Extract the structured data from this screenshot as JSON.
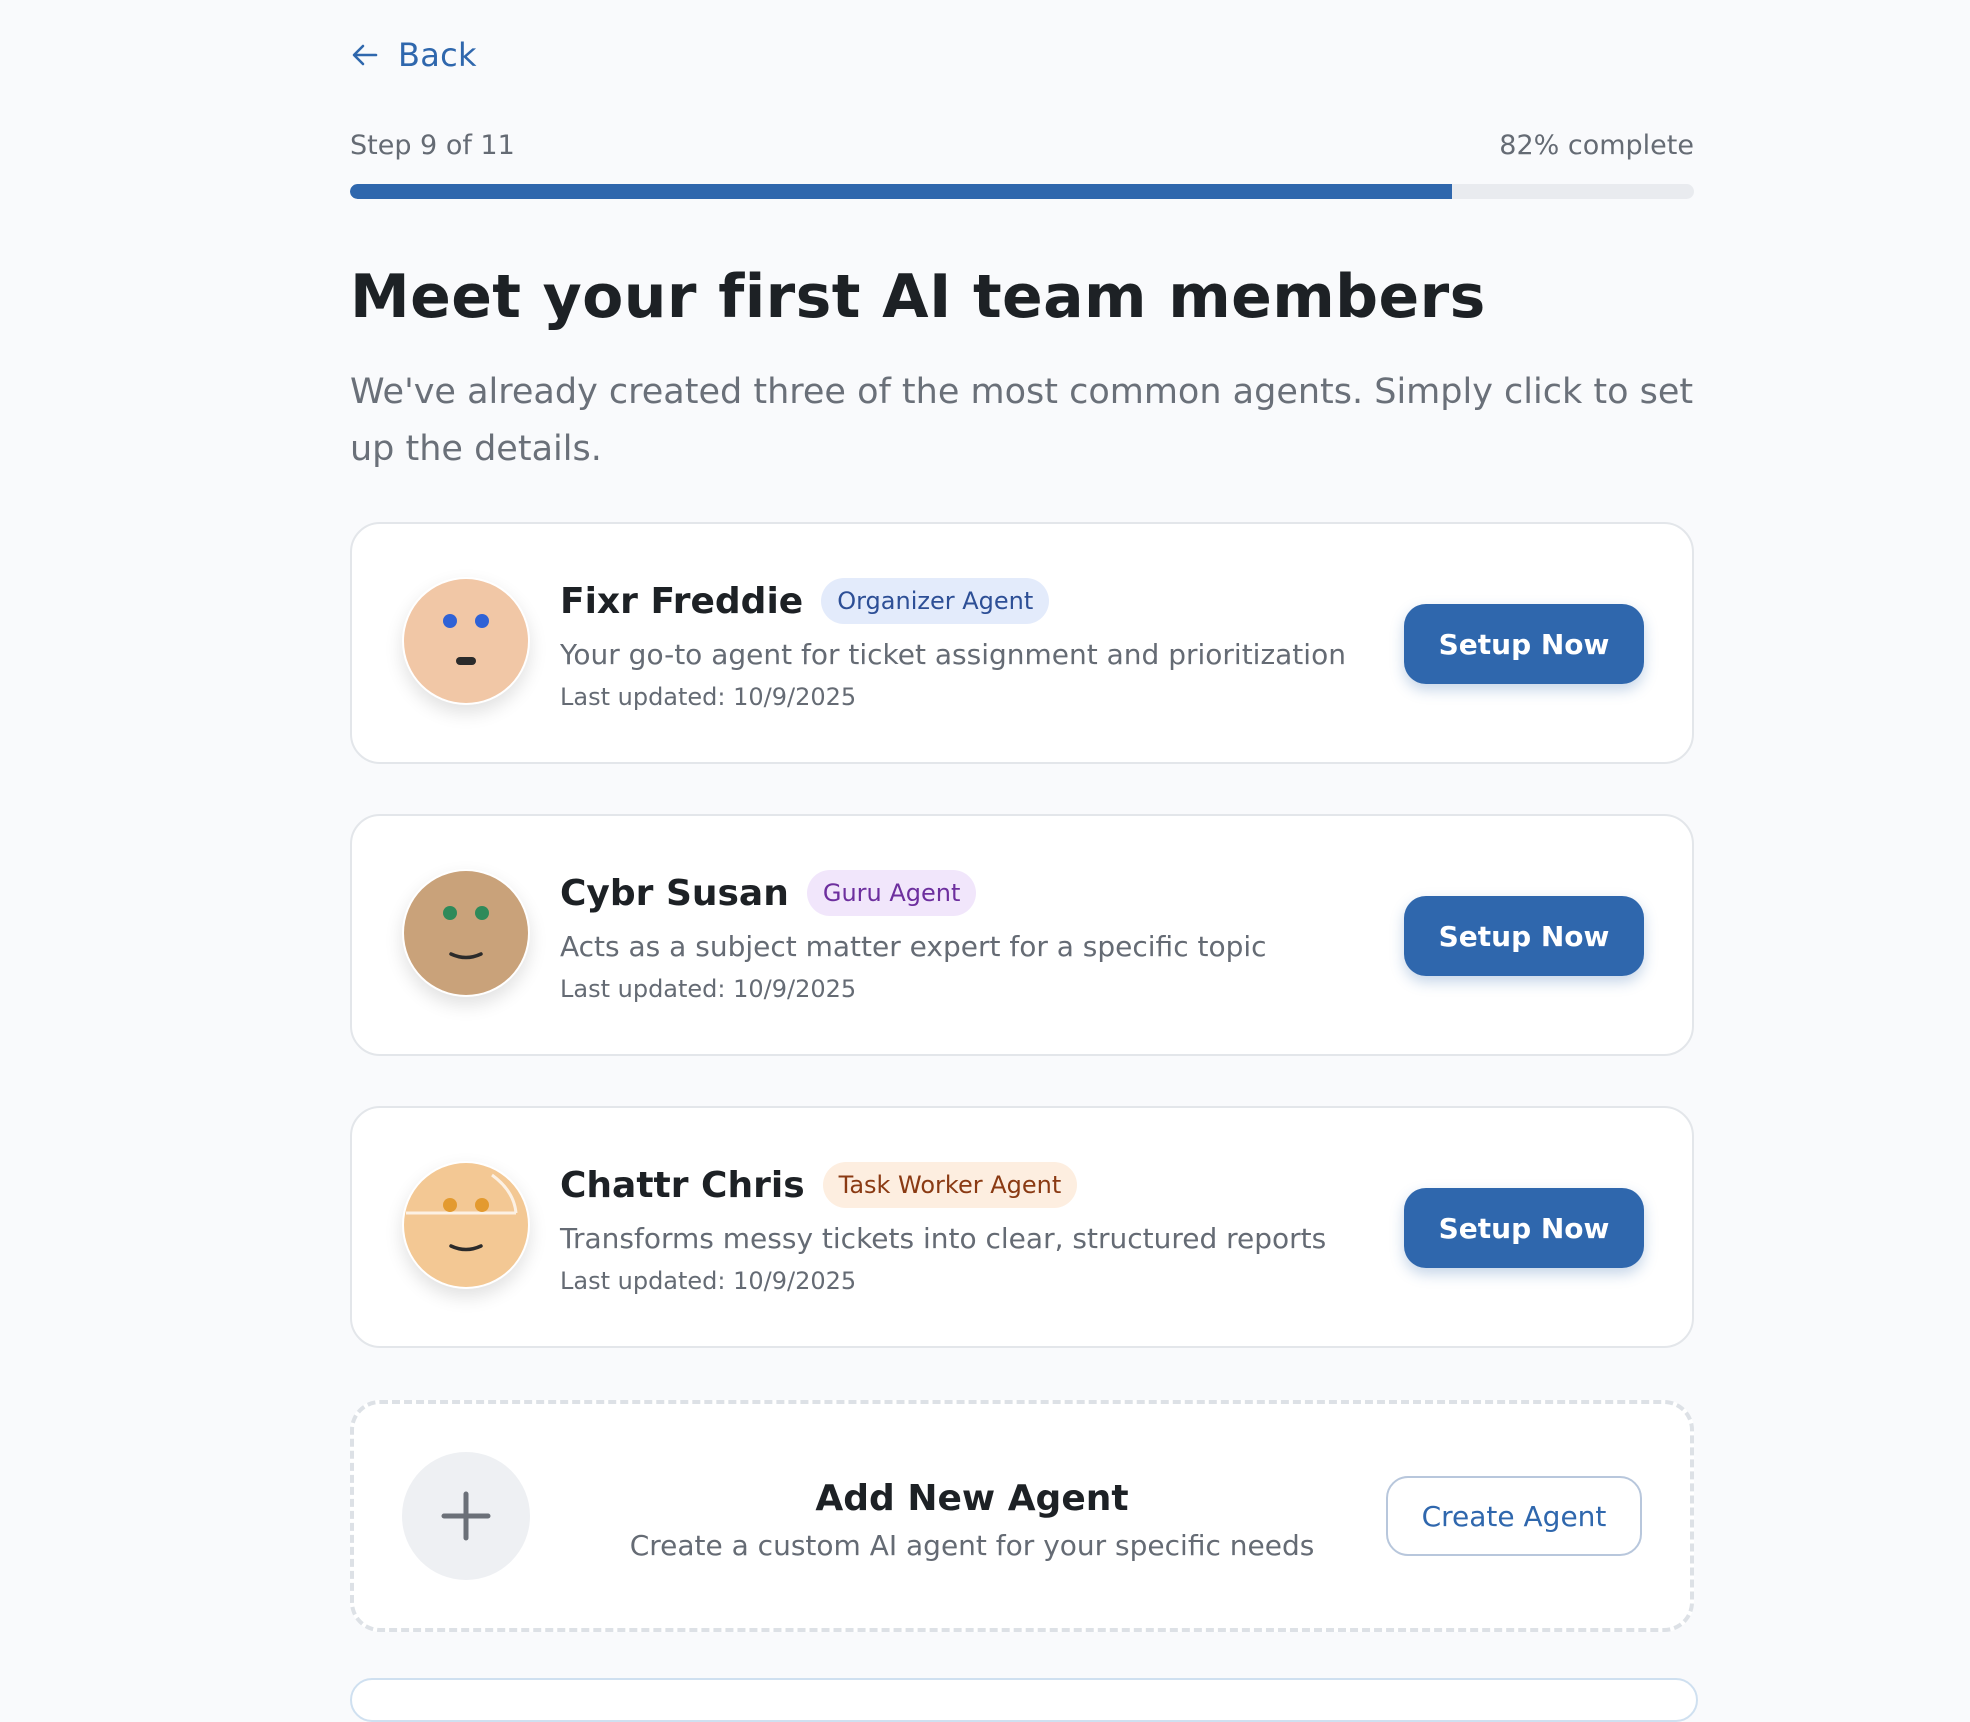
{
  "nav": {
    "back_label": "Back"
  },
  "progress": {
    "step_text": "Step 9 of 11",
    "complete_text": "82% complete",
    "fraction": 0.82,
    "color": "#2f67ad"
  },
  "header": {
    "title": "Meet your first AI team members",
    "subtitle": "We've already created three of the most common agents. Simply click to set up the details."
  },
  "agents": [
    {
      "name": "Fixr Freddie",
      "badge": "Organizer Agent",
      "badge_bg": "#e3ebfb",
      "badge_fg": "#2d4f96",
      "description": "Your go-to agent for ticket assignment and prioritization",
      "updated": "Last updated: 10/9/2025",
      "button": "Setup Now",
      "avatar": {
        "skin": "#f1c7a6",
        "eyes": "#2f62d6",
        "mouth": "flat"
      }
    },
    {
      "name": "Cybr Susan",
      "badge": "Guru Agent",
      "badge_bg": "#f1e6fb",
      "badge_fg": "#6d2f9e",
      "description": "Acts as a subject matter expert for a specific topic",
      "updated": "Last updated: 10/9/2025",
      "button": "Setup Now",
      "avatar": {
        "skin": "#c9a27a",
        "eyes": "#2e8a5a",
        "mouth": "smile"
      }
    },
    {
      "name": "Chattr Chris",
      "badge": "Task Worker Agent",
      "badge_bg": "#fdeee0",
      "badge_fg": "#8a3a13",
      "description": "Transforms messy tickets into clear, structured reports",
      "updated": "Last updated: 10/9/2025",
      "button": "Setup Now",
      "avatar": {
        "skin": "#f3c894",
        "eyes": "#e39a2f",
        "mouth": "smile"
      }
    }
  ],
  "add_agent": {
    "title": "Add New Agent",
    "description": "Create a custom AI agent for your specific needs",
    "button": "Create Agent"
  }
}
